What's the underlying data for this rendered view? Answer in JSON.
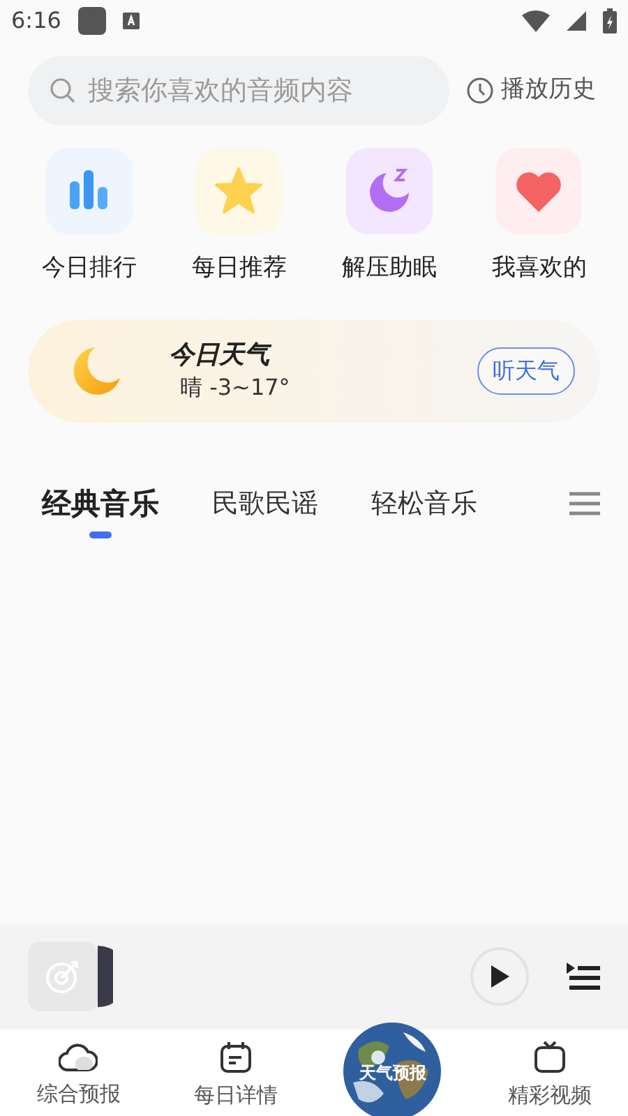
{
  "status_bar": {
    "time": "6:16"
  },
  "search": {
    "placeholder": "搜索你喜欢的音频内容"
  },
  "history_link": "播放历史",
  "shortcuts": [
    {
      "kind": "chart",
      "label": "今日排行"
    },
    {
      "kind": "star",
      "label": "每日推荐"
    },
    {
      "kind": "sleep",
      "label": "解压助眠"
    },
    {
      "kind": "heart",
      "label": "我喜欢的"
    }
  ],
  "weather": {
    "title": "今日天气",
    "summary": "晴 -3~17°",
    "button": "听天气"
  },
  "tabs": [
    {
      "label": "经典音乐",
      "selected": true
    },
    {
      "label": "民歌民谣",
      "selected": false
    },
    {
      "label": "轻松音乐",
      "selected": false
    }
  ],
  "bottom_nav": [
    {
      "kind": "cloud",
      "label": "综合预报"
    },
    {
      "kind": "calendar",
      "label": "每日详情"
    },
    {
      "kind": "globe",
      "label": "天气预报"
    },
    {
      "kind": "video",
      "label": "精彩视频"
    }
  ]
}
